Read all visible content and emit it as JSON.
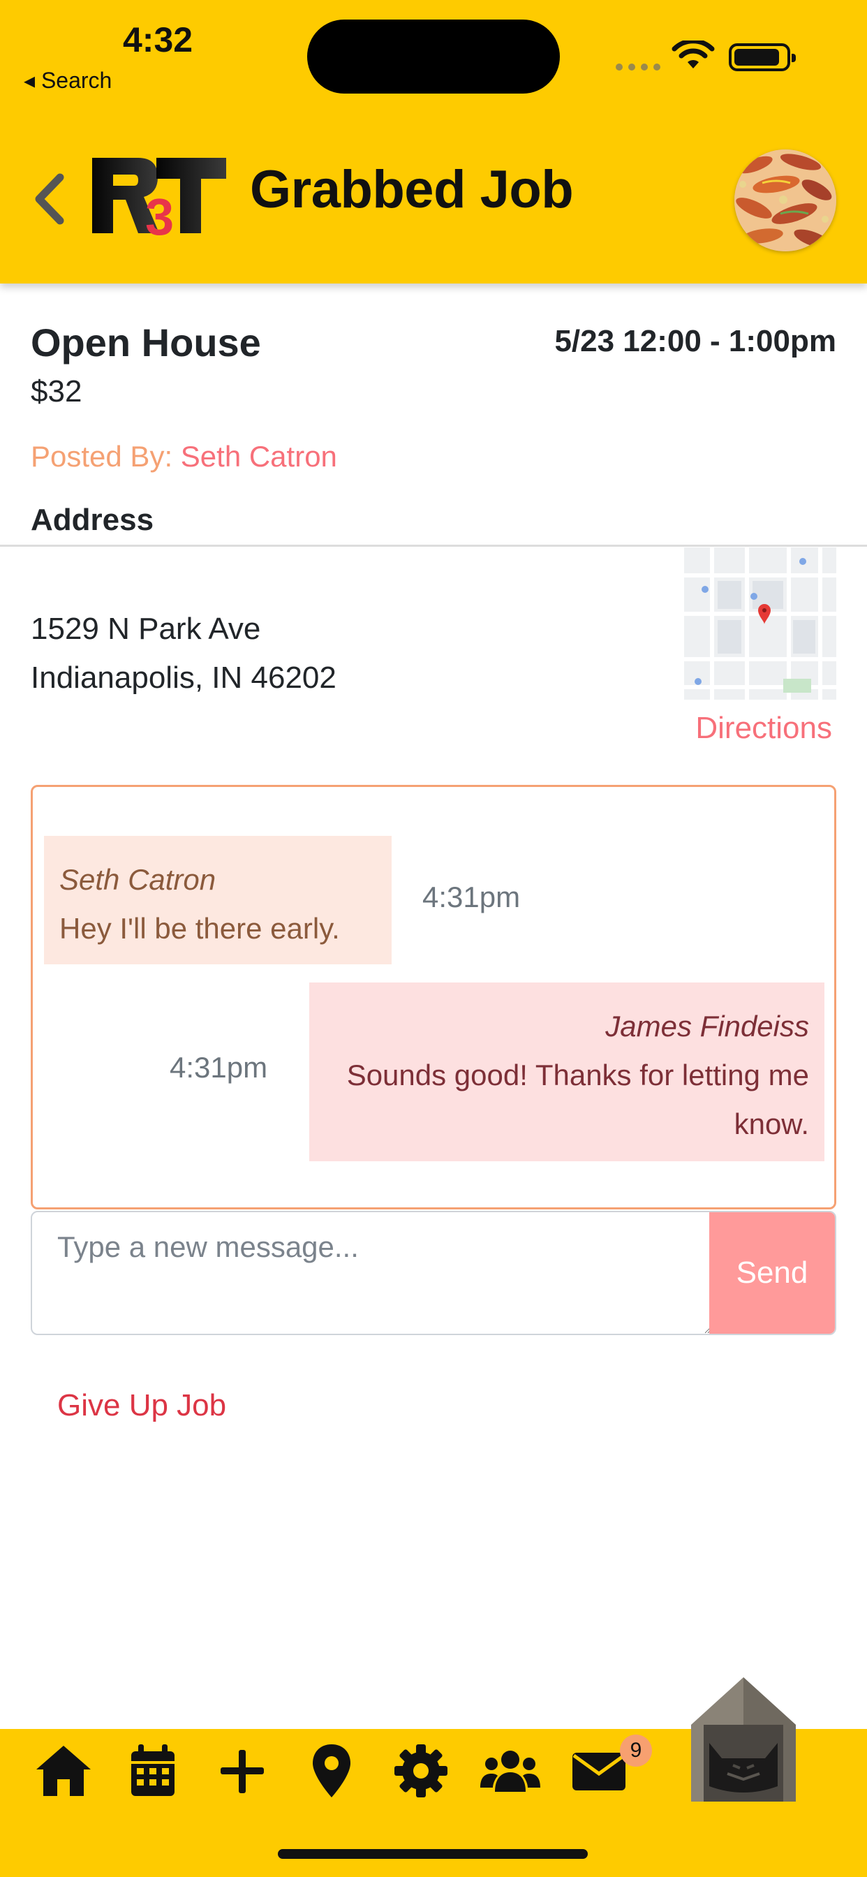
{
  "status_bar": {
    "time": "4:32",
    "back_app_label": "◂ Search"
  },
  "header": {
    "title": "Grabbed Job",
    "logo_text": "R3T",
    "background_color": "#fecb00"
  },
  "job": {
    "title": "Open House",
    "price": "$32",
    "time_range": "5/23 12:00 - 1:00pm",
    "posted_by_label": "Posted By: ",
    "posted_by_name": "Seth Catron",
    "address_label": "Address",
    "address_line1": "1529 N Park Ave",
    "address_line2": "Indianapolis, IN 46202",
    "directions_label": "Directions"
  },
  "chat": {
    "messages": [
      {
        "sender": "Seth Catron",
        "text": "Hey I'll be there early.",
        "time": "4:31pm",
        "direction": "incoming"
      },
      {
        "sender": "James Findeiss",
        "text": "Sounds good! Thanks for letting me know.",
        "time": "4:31pm",
        "direction": "outgoing"
      }
    ],
    "input_placeholder": "Type a new message...",
    "send_label": "Send"
  },
  "actions": {
    "give_up_label": "Give Up Job"
  },
  "tabbar": {
    "tabs": [
      "home-icon",
      "calendar-icon",
      "plus-icon",
      "location-pin-icon",
      "gear-icon",
      "users-icon",
      "envelope-icon"
    ],
    "mail_badge_count": "9"
  },
  "colors": {
    "accent_yellow": "#fecb00",
    "link_coral": "#f7707a",
    "danger_red": "#dc3545",
    "send_button": "#ff9a9a"
  }
}
